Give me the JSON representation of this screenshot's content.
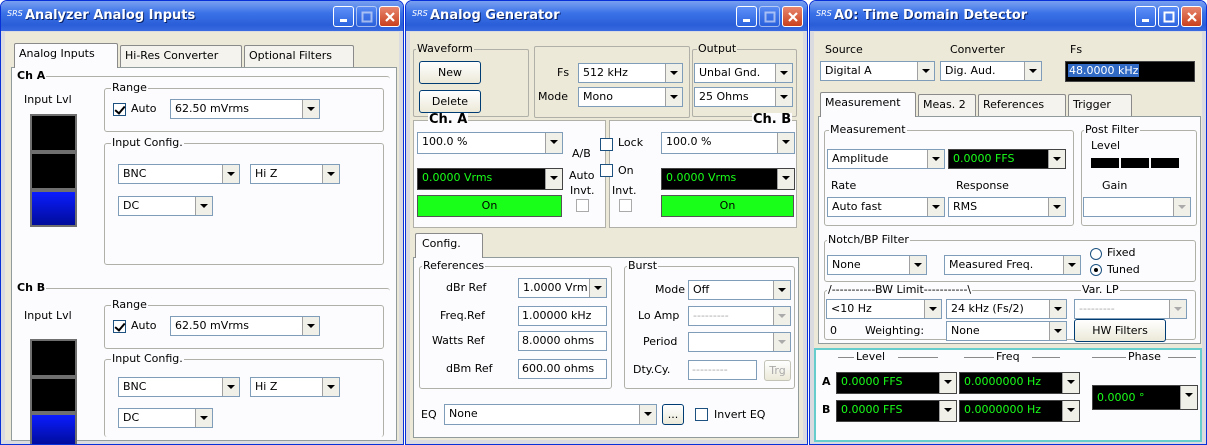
{
  "colors": {
    "title_bar": "#2a5ed8",
    "meter_blue": "#0b1cff",
    "on_green": "#19ff19",
    "readout_green": "#19ff19"
  },
  "icons": [
    "srs-logo-icon",
    "minimize-icon",
    "maximize-icon",
    "close-icon",
    "chevron-down-icon"
  ],
  "logo_text": "SRS",
  "analyzer": {
    "title": "Analyzer Analog Inputs",
    "tabs": [
      "Analog Inputs",
      "Hi-Res Converter",
      "Optional Filters"
    ],
    "ch_a": {
      "label": "Ch A",
      "input_lvl": "Input Lvl",
      "range": "Range",
      "auto": "Auto",
      "range_value": "62.50 mVrms",
      "input_config": "Input Config.",
      "connector": "BNC",
      "impedance": "Hi Z",
      "coupling": "DC"
    },
    "ch_b": {
      "label": "Ch B",
      "input_lvl": "Input Lvl",
      "range": "Range",
      "auto": "Auto",
      "range_value": "62.50 mVrms",
      "input_config": "Input Config.",
      "connector": "BNC",
      "impedance": "Hi Z",
      "coupling": "DC"
    }
  },
  "generator": {
    "title": "Analog Generator",
    "waveform": "Waveform",
    "new_btn": "New",
    "delete_btn": "Delete",
    "fs_label": "Fs",
    "fs_value": "512 kHz",
    "mode_label": "Mode",
    "mode_value": "Mono",
    "output": "Output",
    "output_type": "Unbal Gnd.",
    "output_z": "25 Ohms",
    "ch_a": "Ch. A",
    "ch_b": "Ch. B",
    "amp_a": "100.0 %",
    "amp_b": "100.0 %",
    "level_a": "0.0000 Vrms",
    "level_b": "0.0000 Vrms",
    "on_a": "On",
    "on_b": "On",
    "ab": "A/B",
    "lock": "Lock",
    "auto": "Auto",
    "on": "On",
    "invt": "Invt.",
    "tab": "Config.",
    "references": "References",
    "dbr_ref_label": "dBr Ref",
    "dbr_ref": "1.0000 Vrms",
    "freq_ref_label": "Freq.Ref",
    "freq_ref": "1.00000 kHz",
    "watts_ref_label": "Watts Ref",
    "watts_ref": "8.0000 ohms",
    "dbm_ref_label": "dBm Ref",
    "dbm_ref": "600.00 ohms",
    "burst": "Burst",
    "burst_mode_label": "Mode",
    "burst_mode": "Off",
    "lo_amp": "Lo Amp",
    "lo_amp_value": "---------",
    "period": "Period",
    "dty_cy": "Dty.Cy.",
    "dty_cy_value": "---------",
    "trg": "Trg",
    "eq_label": "EQ",
    "eq_value": "None",
    "eq_more": "...",
    "invert_eq": "Invert EQ"
  },
  "detector": {
    "title": "A0: Time Domain Detector",
    "source_label": "Source",
    "source": "Digital A",
    "converter_label": "Converter",
    "converter": "Dig. Aud.",
    "fs_label": "Fs",
    "fs": "48.0000 kHz",
    "tabs": [
      "Measurement",
      "Meas. 2",
      "References",
      "Trigger"
    ],
    "measurement_label": "Measurement",
    "measurement": "Amplitude",
    "measurement_readout": "0.0000 FFS",
    "rate_label": "Rate",
    "rate": "Auto fast",
    "response_label": "Response",
    "response": "RMS",
    "post_filter": "Post Filter",
    "level": "Level",
    "gain": "Gain",
    "notch": "Notch/BP Filter",
    "notch_value": "None",
    "notch_freq": "Measured Freq.",
    "fixed": "Fixed",
    "tuned": "Tuned",
    "bw_limit": "/-----------BW Limit-----------\\",
    "bw_low": "<10 Hz",
    "bw_high": "24 kHz (Fs/2)",
    "var_lp": "Var. LP",
    "var_lp_value": "---------",
    "zero": "0",
    "weighting_label": "Weighting:",
    "weighting": "None",
    "hw_filters": "HW Filters",
    "readout_level": "Level",
    "readout_freq": "Freq",
    "readout_phase": "Phase",
    "row_a": "A",
    "row_b": "B",
    "level_a": "0.0000 FFS",
    "freq_a": "0.0000000 Hz",
    "level_b": "0.0000 FFS",
    "freq_b": "0.0000000 Hz",
    "phase": "0.0000 °"
  }
}
